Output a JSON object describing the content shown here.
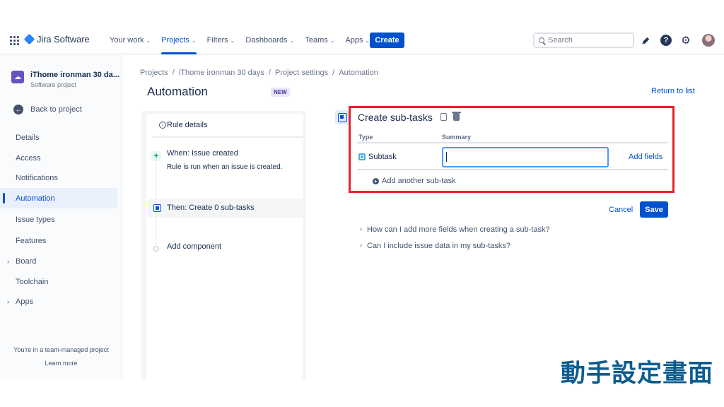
{
  "topnav": {
    "brand": "Jira Software",
    "items": [
      {
        "label": "Your work"
      },
      {
        "label": "Projects"
      },
      {
        "label": "Filters"
      },
      {
        "label": "Dashboards"
      },
      {
        "label": "Teams"
      },
      {
        "label": "Apps"
      }
    ],
    "create_label": "Create",
    "search_placeholder": "Search",
    "icons": [
      "apps-grid-icon",
      "notification-icon",
      "help-icon",
      "settings-icon",
      "avatar"
    ]
  },
  "sidebar": {
    "project_name": "iThome ironman 30 da...",
    "project_type": "Software project",
    "back_label": "Back to project",
    "items": [
      {
        "label": "Details"
      },
      {
        "label": "Access"
      },
      {
        "label": "Notifications"
      },
      {
        "label": "Automation"
      },
      {
        "label": "Issue types"
      },
      {
        "label": "Features"
      },
      {
        "label": "Board"
      },
      {
        "label": "Toolchain"
      },
      {
        "label": "Apps"
      }
    ],
    "footer_text": "You're in a team-managed project",
    "learn_more": "Learn more"
  },
  "breadcrumb": [
    "Projects",
    "/",
    "iThome ironman 30 days",
    "/",
    "Project settings",
    "/",
    "Automation"
  ],
  "page": {
    "title": "Automation",
    "badge": "NEW",
    "return_link": "Return to list"
  },
  "rule": {
    "details_label": "Rule details",
    "trigger_title": "When: Issue created",
    "trigger_desc": "Rule is run when an issue is created.",
    "action_title": "Then: Create 0 sub-tasks",
    "add_component": "Add component"
  },
  "config": {
    "title": "Create sub-tasks",
    "col_type": "Type",
    "col_summary": "Summary",
    "row_type": "Subtask",
    "summary_value": "",
    "add_fields": "Add fields",
    "add_another": "Add another sub-task",
    "cancel": "Cancel",
    "save": "Save",
    "faq": [
      "How can I add more fields when creating a sub-task?",
      "Can I include issue data in my sub-tasks?"
    ]
  },
  "caption": "動手設定畫面",
  "colors": {
    "accent": "#0052cc",
    "highlight_frame": "#e8232a",
    "caption": "#0c5c8e"
  }
}
